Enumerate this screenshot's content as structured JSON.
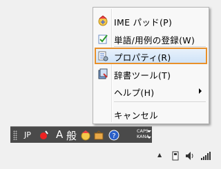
{
  "menu": {
    "items": [
      {
        "label": "IME パッド(P)",
        "icon": "ime-pad-icon"
      },
      {
        "label": "単語/用例の登録(W)",
        "icon": "word-register-icon"
      },
      {
        "label": "プロパティ(R)",
        "icon": "properties-icon",
        "selected": true
      },
      {
        "label": "辞書ツール(T)",
        "icon": "dictionary-tool-icon"
      },
      {
        "label": "ヘルプ(H)",
        "has_submenu": true
      },
      {
        "label": "キャンセル"
      }
    ]
  },
  "langbar": {
    "language": "JP",
    "input_mode": "A",
    "conversion_mode": "般",
    "caps": "CAPS",
    "kana": "KANA"
  },
  "colors": {
    "highlight_border": "#e8902a",
    "langbar_bg": "#4a4a4a"
  }
}
